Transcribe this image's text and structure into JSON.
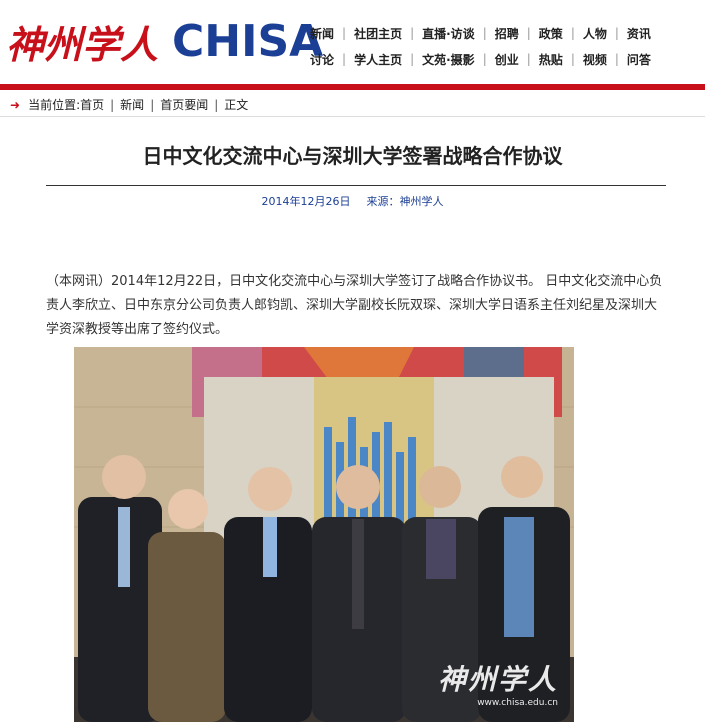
{
  "header": {
    "logo_cn": "神州学人",
    "logo_en": "CHISA",
    "nav_row1": [
      "新闻",
      "社团主页",
      "直播·访谈",
      "招聘",
      "政策",
      "人物",
      "资讯"
    ],
    "nav_row2": [
      "讨论",
      "学人主页",
      "文苑·摄影",
      "创业",
      "热贴",
      "视频",
      "问答"
    ]
  },
  "breadcrumb": {
    "label": "当前位置:",
    "items": [
      "首页",
      "新闻",
      "首页要闻",
      "正文"
    ]
  },
  "article": {
    "title": "日中文化交流中心与深圳大学签署战略合作协议",
    "date": "2014年12月26日",
    "source": "来源：神州学人",
    "paragraph": "（本网讯）2014年12月22日，日中文化交流中心与深圳大学签订了战略合作协议书。 日中文化交流中心负责人李欣立、日中东京分公司负责人郎钧凯、深圳大学副校长阮双琛、深圳大学日语系主任刘纪星及深圳大学资深教授等出席了签约仪式。"
  },
  "photo": {
    "watermark_cn": "神州学人",
    "watermark_url": "www.chisa.edu.cn"
  },
  "colors": {
    "brand_red": "#c8101b",
    "brand_blue": "#1b3f95"
  }
}
